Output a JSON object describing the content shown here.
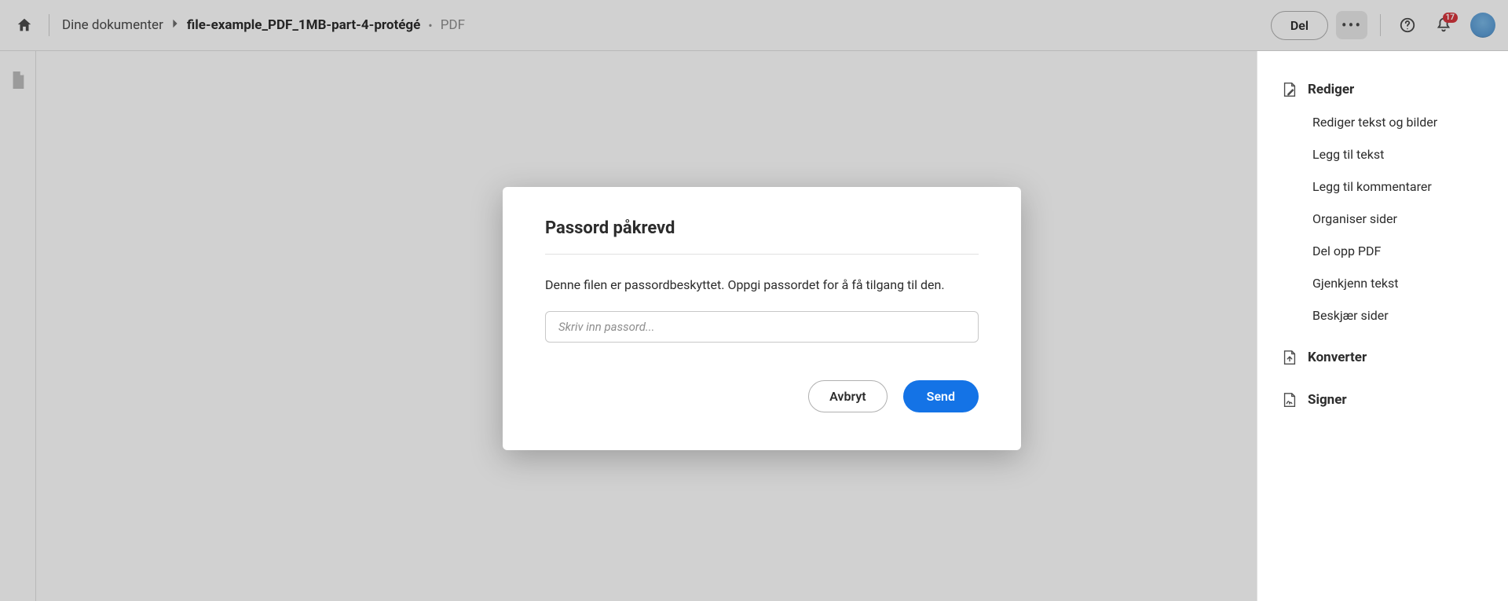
{
  "breadcrumb": {
    "parent": "Dine dokumenter",
    "current": "file-example_PDF_1MB-part-4-protégé",
    "ext": "PDF"
  },
  "topbar": {
    "share_label": "Del",
    "notifications_count": "17"
  },
  "right_panel": {
    "sections": [
      {
        "title": "Rediger",
        "items": [
          "Rediger tekst og bilder",
          "Legg til tekst",
          "Legg til kommentarer",
          "Organiser sider",
          "Del opp PDF",
          "Gjenkjenn tekst",
          "Beskjær sider"
        ]
      },
      {
        "title": "Konverter",
        "items": []
      },
      {
        "title": "Signer",
        "items": []
      }
    ]
  },
  "dialog": {
    "title": "Passord påkrevd",
    "text": "Denne filen er passordbeskyttet. Oppgi passordet for å få tilgang til den.",
    "placeholder": "Skriv inn passord...",
    "cancel_label": "Avbryt",
    "submit_label": "Send"
  }
}
